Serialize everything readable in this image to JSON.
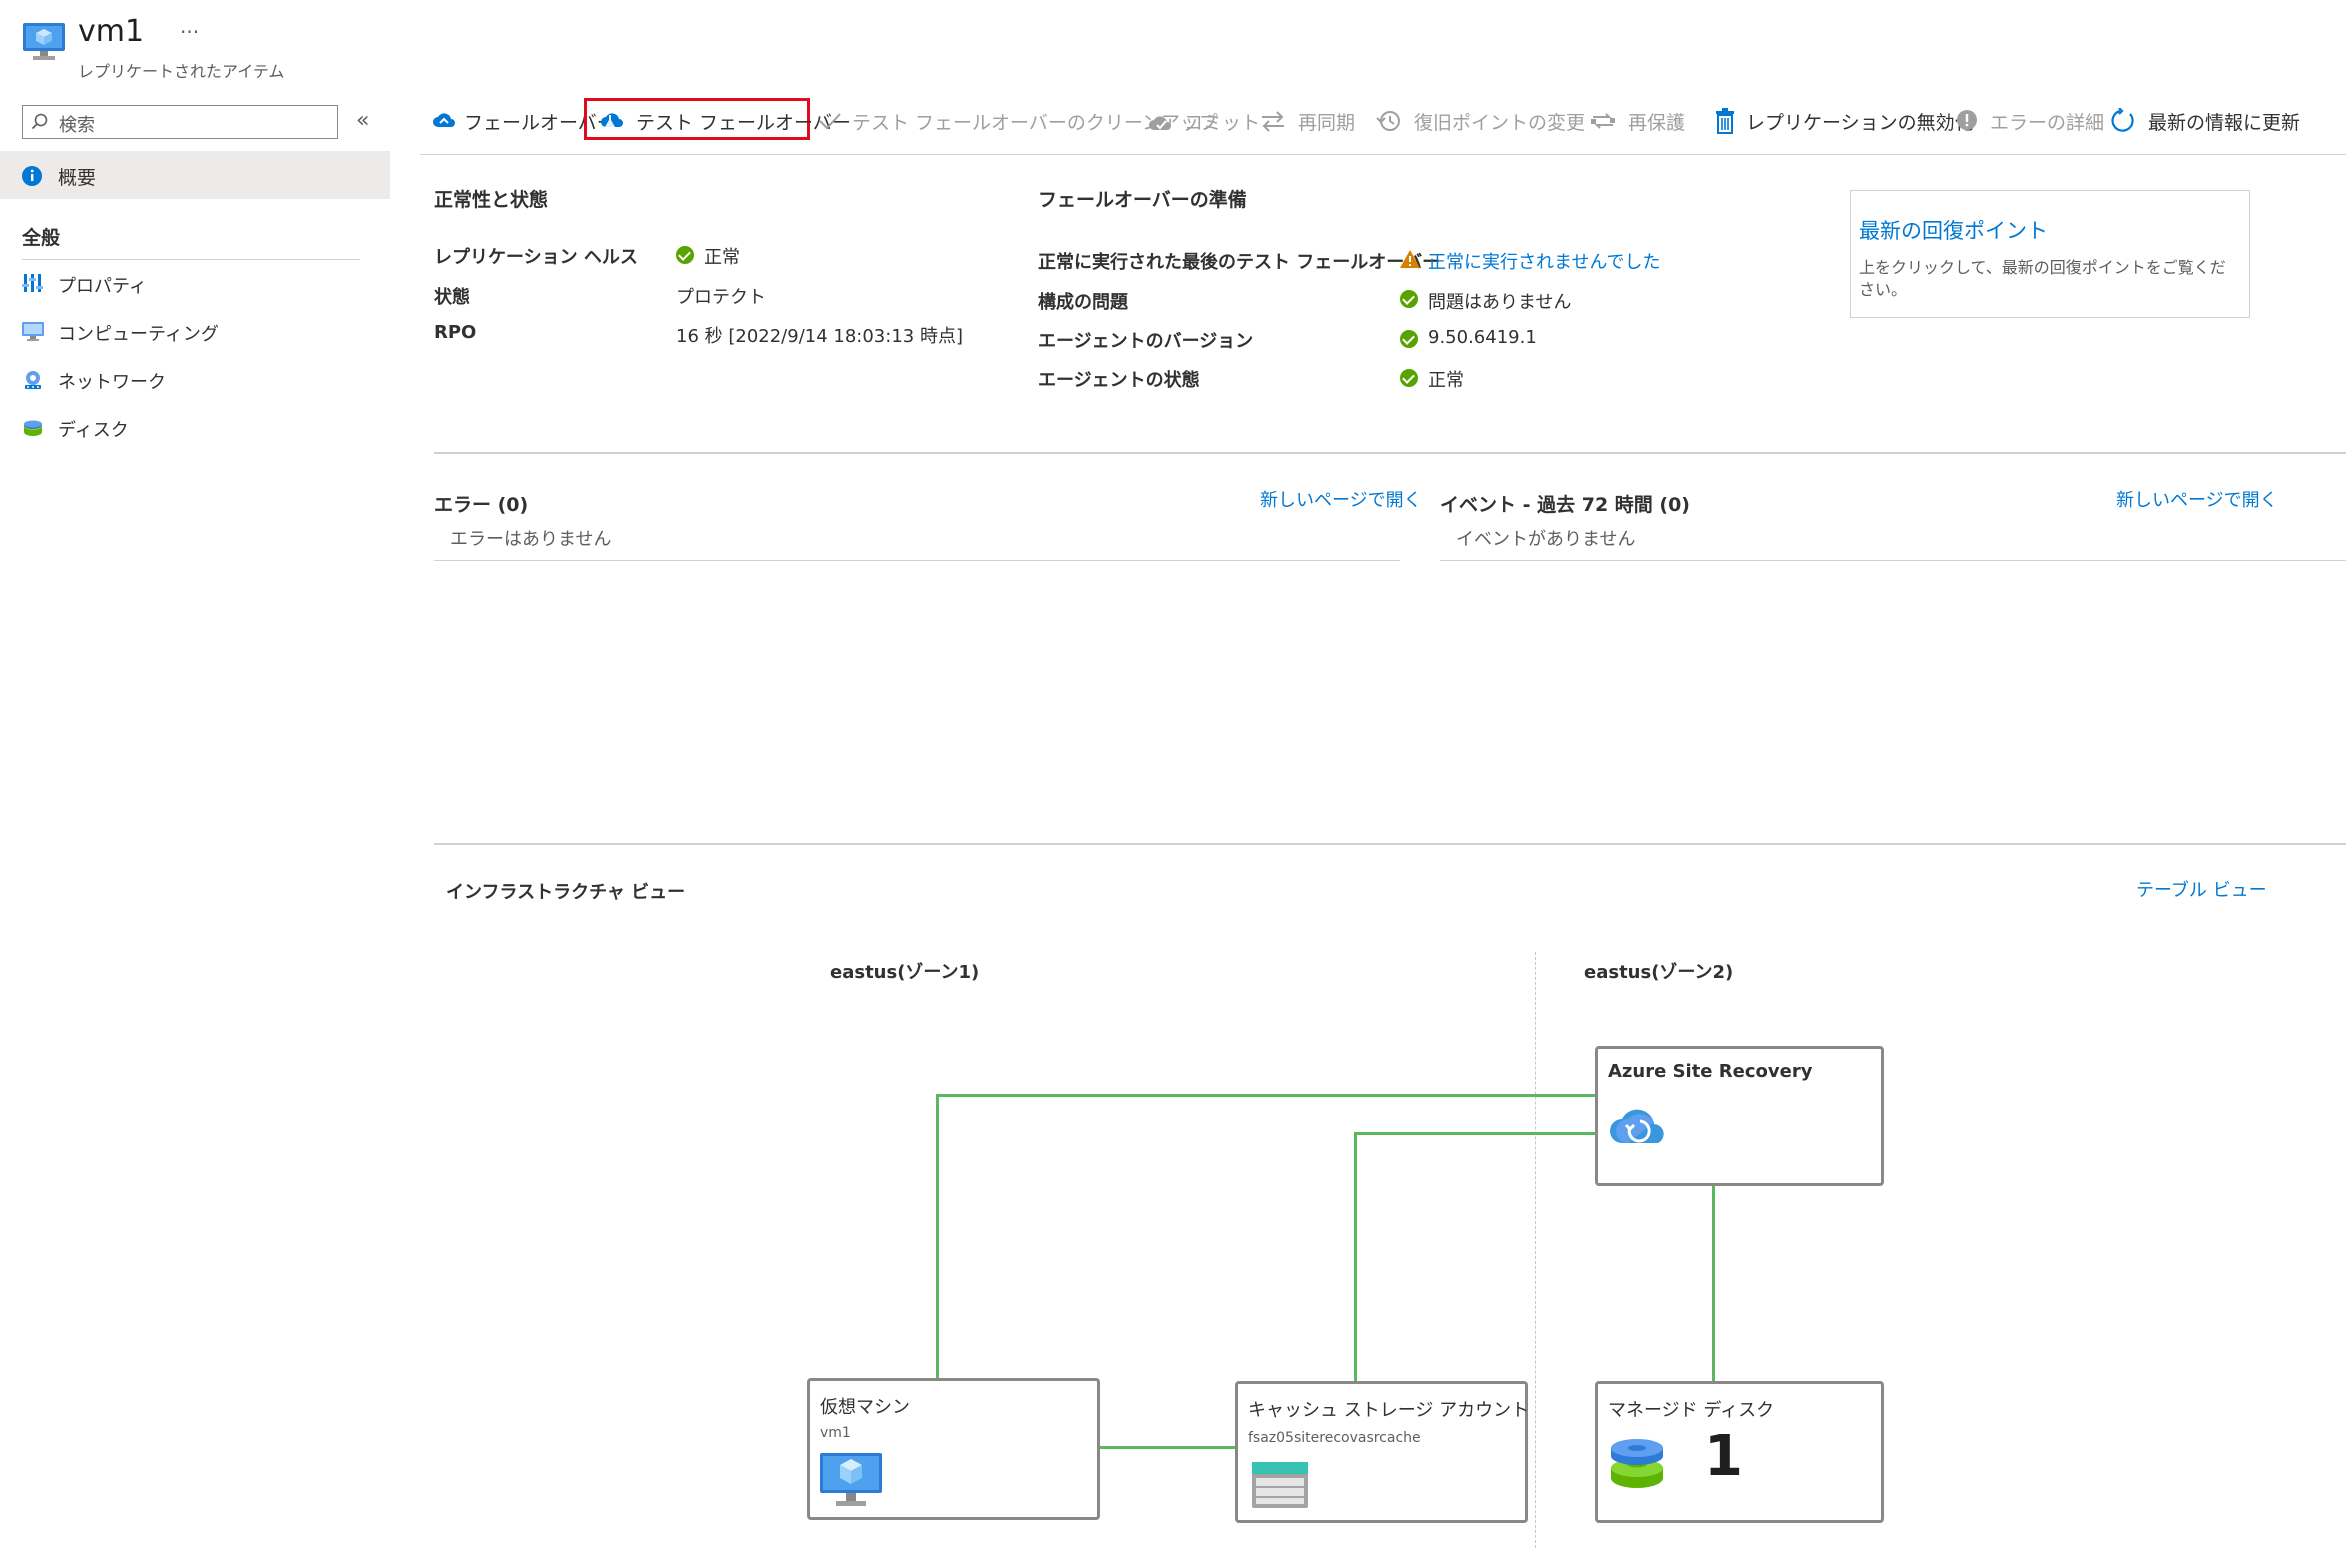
{
  "header": {
    "title": "vm1",
    "more": "···",
    "subtitle": "レプリケートされたアイテム"
  },
  "sidebar": {
    "search_placeholder": "検索",
    "collapse": "«",
    "overview": "概要",
    "section_general": "全般",
    "items": [
      {
        "label": "プロパティ",
        "icon": "properties-icon"
      },
      {
        "label": "コンピューティング",
        "icon": "compute-icon"
      },
      {
        "label": "ネットワーク",
        "icon": "network-icon"
      },
      {
        "label": "ディスク",
        "icon": "disk-icon"
      }
    ]
  },
  "toolbar": {
    "failover": "フェールオーバー",
    "test_failover": "テスト フェールオーバー",
    "cleanup": "テスト フェールオーバーのクリーンアップ",
    "commit": "コミット",
    "resync": "再同期",
    "change_recovery_point": "復旧ポイントの変更",
    "reprotect": "再保護",
    "disable_replication": "レプリケーションの無効化",
    "error_details": "エラーの詳細",
    "refresh": "最新の情報に更新"
  },
  "health": {
    "heading": "正常性と状態",
    "rows": [
      {
        "label": "レプリケーション ヘルス",
        "value": "正常"
      },
      {
        "label": "状態",
        "value": "プロテクト"
      },
      {
        "label": "RPO",
        "value": "16 秒 [2022/9/14 18:03:13 時点]"
      }
    ]
  },
  "readiness": {
    "heading": "フェールオーバーの準備",
    "rows": [
      {
        "label": "正常に実行された最後のテスト フェールオーバー",
        "value": "正常に実行されませんでした"
      },
      {
        "label": "構成の問題",
        "value": "問題はありません"
      },
      {
        "label": "エージェントのバージョン",
        "value": "9.50.6419.1"
      },
      {
        "label": "エージェントの状態",
        "value": "正常"
      }
    ]
  },
  "recovery_card": {
    "title": "最新の回復ポイント",
    "text": "上をクリックして、最新の回復ポイントをご覧ください。"
  },
  "errors": {
    "heading": "エラー (0)",
    "open_link": "新しいページで開く",
    "empty": "エラーはありません"
  },
  "events": {
    "heading": "イベント - 過去 72 時間 (0)",
    "open_link": "新しいページで開く",
    "empty": "イベントがありません"
  },
  "infra": {
    "heading": "インフラストラクチャ ビュー",
    "table_view": "テーブル ビュー",
    "zone1": "eastus(ゾーン1)",
    "zone2": "eastus(ゾーン2)",
    "asr_title": "Azure Site Recovery",
    "vm_title": "仮想マシン",
    "vm_sub": "vm1",
    "cache_title": "キャッシュ ストレージ アカウント",
    "cache_sub": "fsaz05siterecovasrcache",
    "disk_title": "マネージド ディスク",
    "disk_count": "1"
  }
}
